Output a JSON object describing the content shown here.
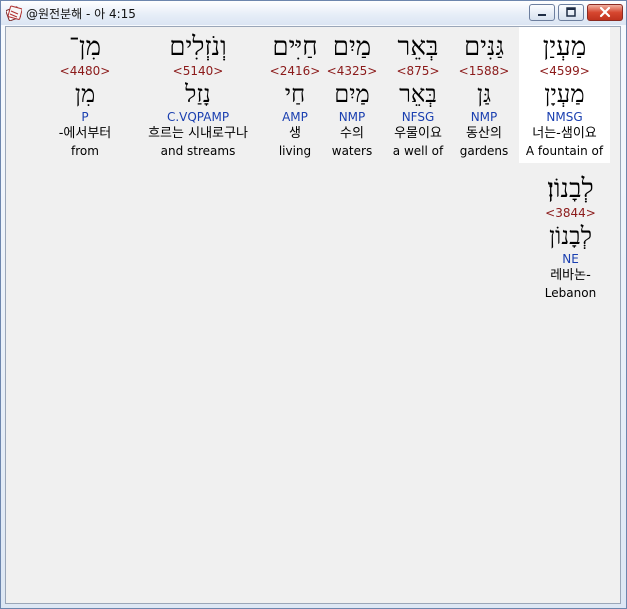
{
  "window": {
    "title": "@원전분해 - 아 4:15"
  },
  "words": [
    {
      "hebrew": "מַעְיַן",
      "strong": "<4599>",
      "lemma": "מַעְיָן",
      "morph": "NMSG",
      "korean": "너는-샘이요",
      "english": "A fountain of",
      "selected": true
    },
    {
      "hebrew": "גַּנִּים",
      "strong": "<1588>",
      "lemma": "גַּן",
      "morph": "NMP",
      "korean": "동산의",
      "english": "gardens",
      "selected": false
    },
    {
      "hebrew": "בְּאֵר",
      "strong": "<875>",
      "lemma": "בְּאֵר",
      "morph": "NFSG",
      "korean": "우물이요",
      "english": "a well of",
      "selected": false
    },
    {
      "hebrew": "מַיִם",
      "strong": "<4325>",
      "lemma": "מַיִם",
      "morph": "NMP",
      "korean": "수의",
      "english": "waters",
      "selected": false
    },
    {
      "hebrew": "חַיִּים",
      "strong": "<2416>",
      "lemma": "חַי",
      "morph": "AMP",
      "korean": "생",
      "english": "living",
      "selected": false
    },
    {
      "hebrew": "וְנֹזְלִים",
      "strong": "<5140>",
      "lemma": "נָזַל",
      "morph": "C.VQPAMP",
      "korean": "흐르는 시내로구나",
      "english": "and streams",
      "selected": false
    },
    {
      "hebrew": "מִן־",
      "strong": "<4480>",
      "lemma": "מִן",
      "morph": "P",
      "korean": "-에서부터",
      "english": "from",
      "selected": false
    },
    {
      "hebrew": "לְבָנוֹן׃",
      "strong": "<3844>",
      "lemma": "לְבָנוֹן",
      "morph": "NE",
      "korean": "레바논-",
      "english": "Lebanon",
      "selected": false
    }
  ]
}
